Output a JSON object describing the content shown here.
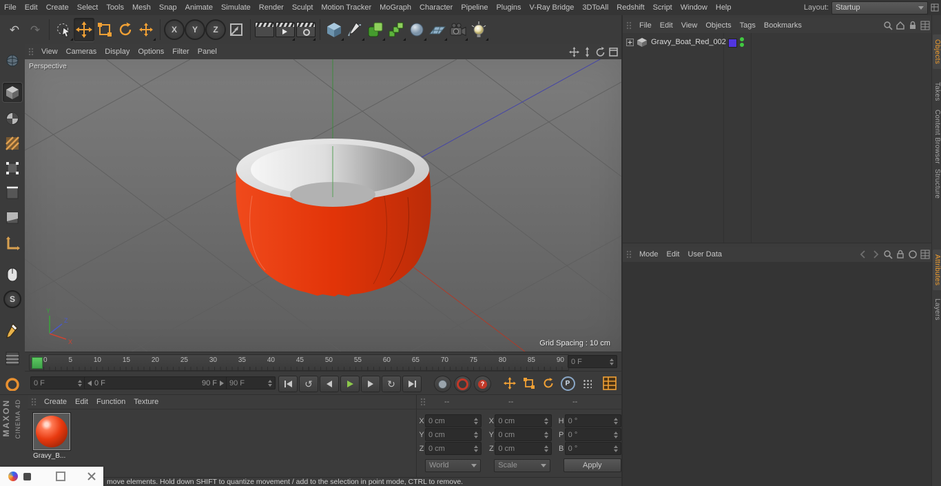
{
  "menubar": {
    "items": [
      "File",
      "Edit",
      "Create",
      "Select",
      "Tools",
      "Mesh",
      "Snap",
      "Animate",
      "Simulate",
      "Render",
      "Sculpt",
      "Motion Tracker",
      "MoGraph",
      "Character",
      "Pipeline",
      "Plugins",
      "V-Ray Bridge",
      "3DToAll",
      "Redshift",
      "Script",
      "Window",
      "Help"
    ],
    "layout_label": "Layout:",
    "layout_value": "Startup"
  },
  "glyphs": {
    "undo": "↶",
    "redo": "↷",
    "loop_ccw": "↺",
    "loop_cw": "↻"
  },
  "toolbar": {
    "axis_x": "X",
    "axis_y": "Y",
    "axis_z": "Z"
  },
  "left_toolbar": {
    "snap_label": "S"
  },
  "viewport": {
    "menu": [
      "View",
      "Cameras",
      "Display",
      "Options",
      "Filter",
      "Panel"
    ],
    "camera_label": "Perspective",
    "grid_spacing": "Grid Spacing : 10 cm",
    "axis_x": "X",
    "axis_y": "Y",
    "axis_z": "Z"
  },
  "timeline": {
    "ticks": [
      "0",
      "5",
      "10",
      "15",
      "20",
      "25",
      "30",
      "35",
      "40",
      "45",
      "50",
      "55",
      "60",
      "65",
      "70",
      "75",
      "80",
      "85",
      "90"
    ],
    "frame_field": "0 F"
  },
  "transport": {
    "current_frame": "0 F",
    "range_start": "0 F",
    "range_end": "90 F",
    "end_frame": "90 F",
    "parameter_label": "P",
    "question_label": "?"
  },
  "materials": {
    "menu": [
      "Create",
      "Edit",
      "Function",
      "Texture"
    ],
    "material_name": "Gravy_B..."
  },
  "coordinates": {
    "headers": [
      "--",
      "--",
      "--"
    ],
    "rows": [
      {
        "l1": "X",
        "v1": "0 cm",
        "l2": "X",
        "v2": "0 cm",
        "l3": "H",
        "v3": "0 °"
      },
      {
        "l1": "Y",
        "v1": "0 cm",
        "l2": "Y",
        "v2": "0 cm",
        "l3": "P",
        "v3": "0 °"
      },
      {
        "l1": "Z",
        "v1": "0 cm",
        "l2": "Z",
        "v2": "0 cm",
        "l3": "B",
        "v3": "0 °"
      }
    ],
    "system": "World",
    "mode": "Scale",
    "apply_label": "Apply"
  },
  "object_manager": {
    "menu": [
      "File",
      "Edit",
      "View",
      "Objects",
      "Tags",
      "Bookmarks"
    ],
    "objects": [
      {
        "name": "Gravy_Boat_Red_002"
      }
    ]
  },
  "attribute_manager": {
    "menu": [
      "Mode",
      "Edit",
      "User Data"
    ]
  },
  "side_tabs": {
    "top": [
      "Objects",
      "Takes",
      "Content Browser",
      "Structure"
    ],
    "bottom": [
      "Attributes",
      "Layers"
    ]
  },
  "brand": {
    "line1": "MAXON",
    "line2": "CINEMA 4D"
  },
  "status": {
    "text": "move elements. Hold down SHIFT to quantize movement / add to the selection in point mode, CTRL to remove."
  },
  "colors": {
    "accent_orange": "#f0a035",
    "object_red": "#e8380d",
    "marker_green": "#44b04a",
    "layer_chip": "#5135e0",
    "play_green": "#8cc84b"
  }
}
